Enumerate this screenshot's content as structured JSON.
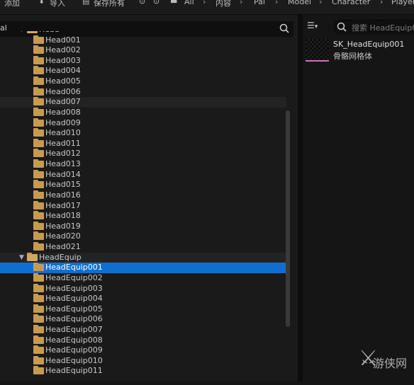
{
  "toolbar": {
    "add_label": "添加",
    "import_label": "导入",
    "save_all_label": "保存所有",
    "breadcrumbs": [
      "All",
      "内容",
      "Pal",
      "Model",
      "Character",
      "Player"
    ]
  },
  "left_search": {
    "value": "al"
  },
  "tree": {
    "parent_folder": "Head",
    "head_items": [
      "Head001",
      "Head002",
      "Head003",
      "Head004",
      "Head005",
      "Head006",
      "Head007",
      "Head008",
      "Head009",
      "Head010",
      "Head011",
      "Head012",
      "Head013",
      "Head014",
      "Head015",
      "Head016",
      "Head017",
      "Head018",
      "Head019",
      "Head020",
      "Head021"
    ],
    "equip_folder": "HeadEquip",
    "equip_items": [
      "HeadEquip001",
      "HeadEquip002",
      "HeadEquip003",
      "HeadEquip004",
      "HeadEquip005",
      "HeadEquip006",
      "HeadEquip007",
      "HeadEquip008",
      "HeadEquip009",
      "HeadEquip010",
      "HeadEquip011"
    ],
    "selected": "HeadEquip001"
  },
  "right_search": {
    "placeholder": "搜索 HeadEquip00"
  },
  "asset": {
    "name": "SK_HeadEquip001",
    "type": "骨骼网格体"
  },
  "watermark": {
    "text": "游侠网"
  },
  "colors": {
    "selection": "#0f6fd1",
    "folder": "#c79a52",
    "asset_type_bar": "#d66bc7"
  },
  "icons": [
    "search-icon",
    "filter-icon",
    "folder-icon",
    "chevron-down-icon",
    "chevron-right-icon",
    "history-icon"
  ]
}
